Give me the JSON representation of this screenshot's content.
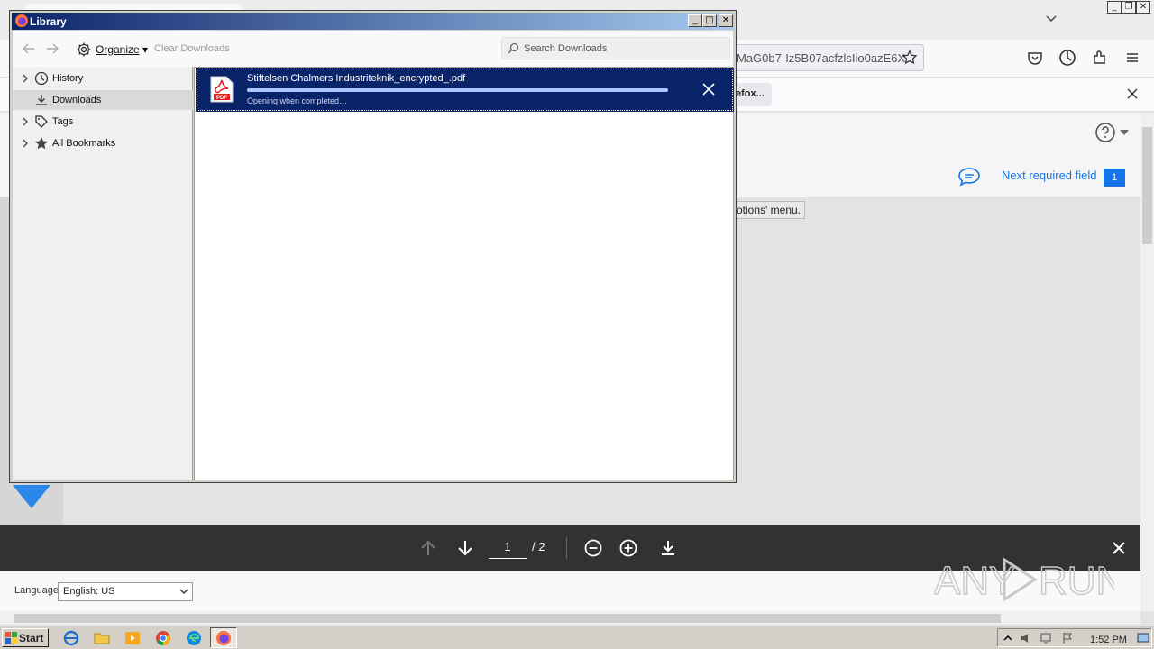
{
  "browser": {
    "address_fragment": "MaG0b7-Iz5B07acfzlsIio0azE6X",
    "notification_button": "efox..."
  },
  "pdf_viewer": {
    "next_required_label": "Next required field",
    "next_required_count": "1",
    "tooltip_fragment": "otions' menu.",
    "page_current": "1",
    "page_total": "/ 2",
    "language_label": "Language",
    "language_value": "English: US"
  },
  "library": {
    "title": "Library",
    "organize_label": "Organize",
    "clear_downloads_label": "Clear Downloads",
    "search_placeholder": "Search Downloads",
    "sidebar": [
      {
        "label": "History",
        "icon": "clock-icon"
      },
      {
        "label": "Downloads",
        "icon": "download-icon"
      },
      {
        "label": "Tags",
        "icon": "tag-icon"
      },
      {
        "label": "All Bookmarks",
        "icon": "star-icon"
      }
    ],
    "download": {
      "filename": "Stiftelsen Chalmers Industriteknik_encrypted_.pdf",
      "status": "Opening when completed…",
      "progress": 1.0
    }
  },
  "taskbar": {
    "start_label": "Start",
    "clock": "1:52 PM"
  },
  "watermark": {
    "text_left": "ANY",
    "text_right": "RUN"
  },
  "colors": {
    "selection_blue": "#0a246a",
    "pdf_accent": "#1473e6",
    "pdf_red": "#e0201c"
  }
}
